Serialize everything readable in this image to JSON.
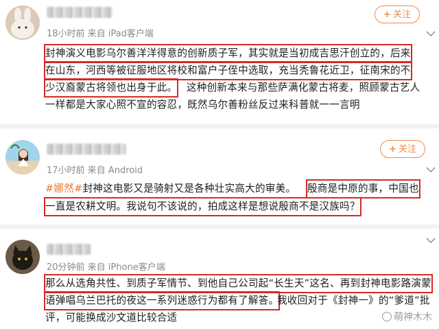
{
  "follow_label": "关注",
  "colors": {
    "accent": "#f08a4b",
    "highlight_box": "#d42a23",
    "hashtag": "#e87a2e",
    "meta": "#8a8a8a"
  },
  "comments": [
    {
      "meta": "18小时前 来自 iPad客户端",
      "avatar": "rabbit-avatar",
      "lines": [
        "封神演义电影乌尔善洋洋得意的创新质子军，其实就是当初成吉思汗创立的，后来",
        "在山东，河西等被征服地区将校和富户子侄中选取，充当秃鲁花近卫，征南宋的不",
        "少汉裔蒙古将领也出身于此。",
        "这种创新本来与那些萨满化蒙古将麦，照顾蒙古艺人",
        "一样都是大家心照不宣的容忍，既然乌尔善粉丝反过来科普就一一言明"
      ]
    },
    {
      "meta": "17小时前 来自 Android",
      "avatar": "girl-avatar",
      "hashtag": "#娜然#",
      "lines": [
        "封神这电影又是骑射又是各种壮实高大的审美。",
        "殷商是中原的事，中国也",
        "一直是农耕文明。我说句不该说的，拍成这样是想说殷商不是汉族吗？"
      ]
    },
    {
      "meta": "20分钟前 来自 iPhone客户端",
      "avatar": "cat-avatar",
      "lines": [
        "那么从选角共性、到质子军情节、到他自己公司起“长生天”这名、再到封神电影路演蒙",
        "语弹唱乌兰巴托的夜这一系列迷惑行为都有了解答。",
        "我收回对于《封神一》的“爹道”批",
        "评，可能换成沙文道比较合适"
      ]
    }
  ],
  "watermark": "萌神木木"
}
